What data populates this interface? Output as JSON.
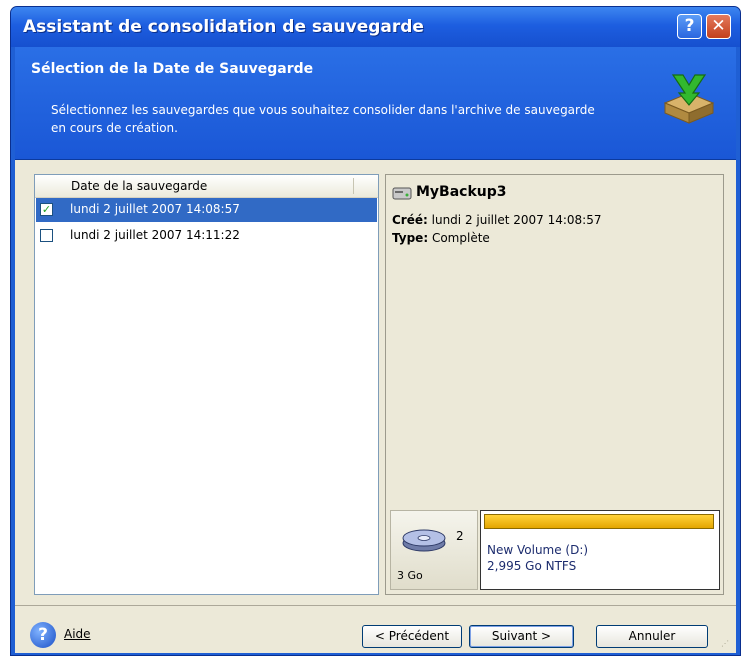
{
  "window": {
    "title": "Assistant de consolidation de sauvegarde",
    "help_button": "?",
    "close_button": "✕"
  },
  "header": {
    "title": "Sélection de la Date de Sauvegarde",
    "description": "Sélectionnez les sauvegardes que vous souhaitez consolider dans l'archive de sauvegarde en cours de création."
  },
  "list": {
    "column_header": "Date de la sauvegarde",
    "rows": [
      {
        "label": "lundi 2 juillet 2007 14:08:57",
        "checked": true,
        "selected": true
      },
      {
        "label": "lundi 2 juillet 2007 14:11:22",
        "checked": false,
        "selected": false
      }
    ]
  },
  "info": {
    "name": "MyBackup3",
    "created_label": "Créé:",
    "created_value": "lundi 2 juillet 2007 14:08:57",
    "type_label": "Type:",
    "type_value": "Complète",
    "disk": {
      "number": "2",
      "size": "3 Go"
    },
    "volume": {
      "name": "New Volume (D:)",
      "size_fs": "2,995 Go  NTFS",
      "bar_color": "#f0b400"
    }
  },
  "footer": {
    "help_label": "Aide",
    "prev_label": "< Précédent",
    "next_label": "Suivant >",
    "cancel_label": "Annuler"
  },
  "colors": {
    "title_bar": "#1d5ee0",
    "selection": "#316ac5",
    "dialog_bg": "#ece9d8"
  }
}
